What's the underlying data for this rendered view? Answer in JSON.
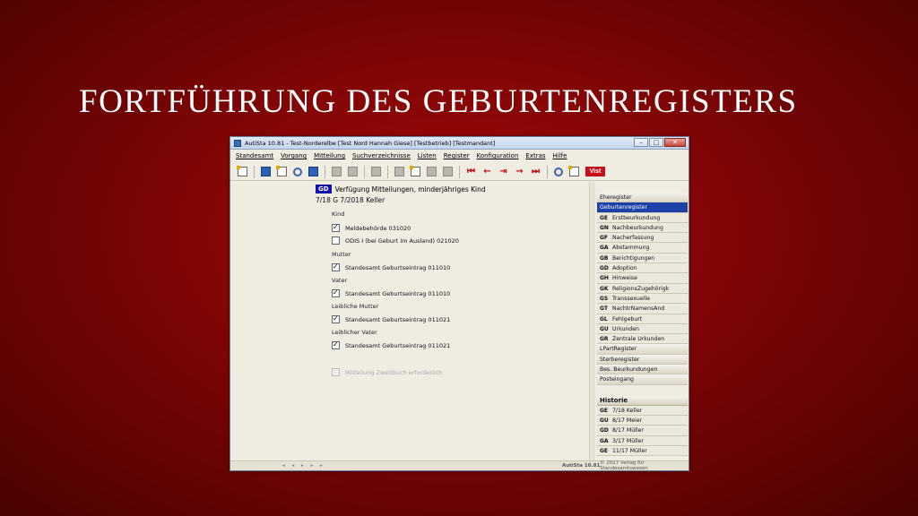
{
  "slide": {
    "title": "Fortführung des Geburtenregisters"
  },
  "window": {
    "title": "AutiSta 10.81 - Test-Norderelbe [Test Nord Hannah Giese] [Testbetrieb] [Testmandant]",
    "controls": {
      "minimize": "–",
      "maximize": "□",
      "close": "✕"
    }
  },
  "menu": [
    "Standesamt",
    "Vorgang",
    "Mitteilung",
    "Suchverzeichnisse",
    "Listen",
    "Register",
    "Konfiguration",
    "Extras",
    "Hilfe"
  ],
  "toolbar": {
    "vist_label": "Vist"
  },
  "header": {
    "badge": "GD",
    "text": "Verfügung Mitteilungen, minderjähriges Kind"
  },
  "case_line": "7/18 G 7/2018 Keller",
  "sections": {
    "kind": "Kind",
    "mutter": "Mutter",
    "vater": "Vater",
    "leibliche_mutter": "Leibliche Mutter",
    "leiblicher_vater": "Leiblicher Vater"
  },
  "checks": {
    "meldebehoerde": {
      "label": "Meldebehörde 031020",
      "checked": true
    },
    "odis": {
      "label": "ODIS I (bei Geburt im Ausland) 021020",
      "checked": false
    },
    "mutter_std": {
      "label": "Standesamt Geburtseintrag 011010",
      "checked": true
    },
    "vater_std": {
      "label": "Standesamt Geburtseintrag 011010",
      "checked": true
    },
    "lmutter_std": {
      "label": "Standesamt Geburtseintrag 011021",
      "checked": true
    },
    "lvater_std": {
      "label": "Standesamt Geburtseintrag 011021",
      "checked": true
    },
    "zweitbuch": {
      "label": "Mitteilung Zweitbuch erforderlich",
      "checked": false
    }
  },
  "right_panel": {
    "groups_top": [
      "Eheregister",
      "Geburtenregister"
    ],
    "items": [
      {
        "code": "GE",
        "label": "Erstbeurkundung"
      },
      {
        "code": "GN",
        "label": "Nachbeurkundung"
      },
      {
        "code": "GF",
        "label": "Nacherfassung"
      },
      {
        "code": "GA",
        "label": "Abstammung"
      },
      {
        "code": "GB",
        "label": "Berichtigungen"
      },
      {
        "code": "GD",
        "label": "Adoption"
      },
      {
        "code": "GH",
        "label": "Hinweise"
      },
      {
        "code": "GK",
        "label": "ReligionsZugehörigk"
      },
      {
        "code": "GS",
        "label": "Transsexuelle"
      },
      {
        "code": "GT",
        "label": "NachtrNamensAnd"
      },
      {
        "code": "GL",
        "label": "Fehlgeburt"
      },
      {
        "code": "GU",
        "label": "Urkunden"
      },
      {
        "code": "GR",
        "label": "Zentrale Urkunden"
      }
    ],
    "groups_bottom": [
      "LPartRegister",
      "Sterberegister",
      "Bes. Beurkundungen",
      "Posteingang"
    ],
    "history_title": "Historie",
    "history": [
      {
        "code": "GE",
        "label": "7/18 Keller"
      },
      {
        "code": "GU",
        "label": "8/17 Meier"
      },
      {
        "code": "GD",
        "label": "8/17 Müller"
      },
      {
        "code": "GA",
        "label": "3/17 Müller"
      },
      {
        "code": "GE",
        "label": "11/17 Müller"
      }
    ]
  },
  "status": {
    "version": "AutiSta 10.81",
    "copyright": "© 2017 Verlag für Standesamtswesen"
  }
}
